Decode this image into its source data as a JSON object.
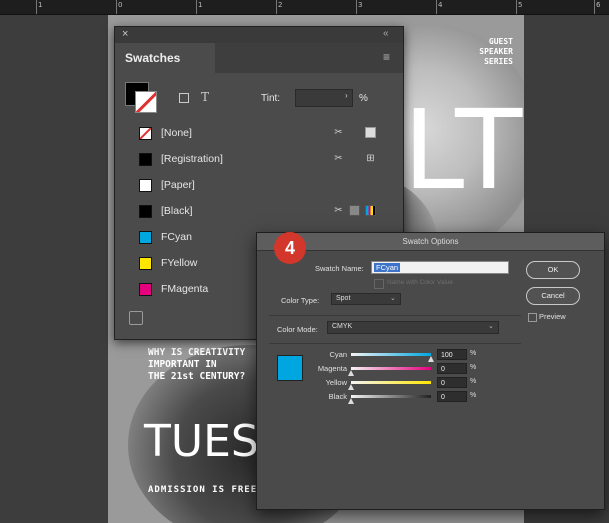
{
  "ruler": {
    "marks": [
      "1",
      "0",
      "1",
      "2",
      "3",
      "4",
      "5",
      "6"
    ]
  },
  "poster": {
    "series": [
      "GUEST",
      "SPEAKER",
      "SERIES"
    ],
    "big_letters": "LT",
    "question": [
      "WHY IS CREATIVITY",
      "IMPORTANT IN",
      "THE 21st CENTURY?"
    ],
    "day": "TUESDA",
    "admission": "ADMISSION IS FREE"
  },
  "swatches": {
    "close_glyph": "×",
    "collapse_glyph": "«",
    "tab_title": "Swatches",
    "menu_glyph": "≡",
    "tint_label": "Tint:",
    "tint_pct": "%",
    "items": [
      {
        "name": "[None]",
        "color": "#ffffff"
      },
      {
        "name": "[Registration]",
        "color": "#000000"
      },
      {
        "name": "[Paper]",
        "color": "#ffffff"
      },
      {
        "name": "[Black]",
        "color": "#000000"
      },
      {
        "name": "FCyan",
        "color": "#00a6e0"
      },
      {
        "name": "FYellow",
        "color": "#ffe600"
      },
      {
        "name": "FMagenta",
        "color": "#e5007e"
      }
    ]
  },
  "dialog": {
    "title": "Swatch Options",
    "swatch_name_label": "Swatch Name:",
    "swatch_name_value": "FCyan",
    "name_with_value": "Name with Color Value",
    "color_type_label": "Color Type:",
    "color_type_value": "Spot",
    "color_mode_label": "Color Mode:",
    "color_mode_value": "CMYK",
    "ok": "OK",
    "cancel": "Cancel",
    "preview": "Preview",
    "preview_color": "#00a6e0",
    "channels": [
      {
        "name": "Cyan",
        "value": "100",
        "fraction": 1.0,
        "color": "#00a6e0"
      },
      {
        "name": "Magenta",
        "value": "0",
        "fraction": 0.0,
        "color": "#e5007e"
      },
      {
        "name": "Yellow",
        "value": "0",
        "fraction": 0.0,
        "color": "#ffe600"
      },
      {
        "name": "Black",
        "value": "0",
        "fraction": 0.0,
        "color": "#222222"
      }
    ],
    "pct_sign": "%"
  },
  "step_badge": "4"
}
